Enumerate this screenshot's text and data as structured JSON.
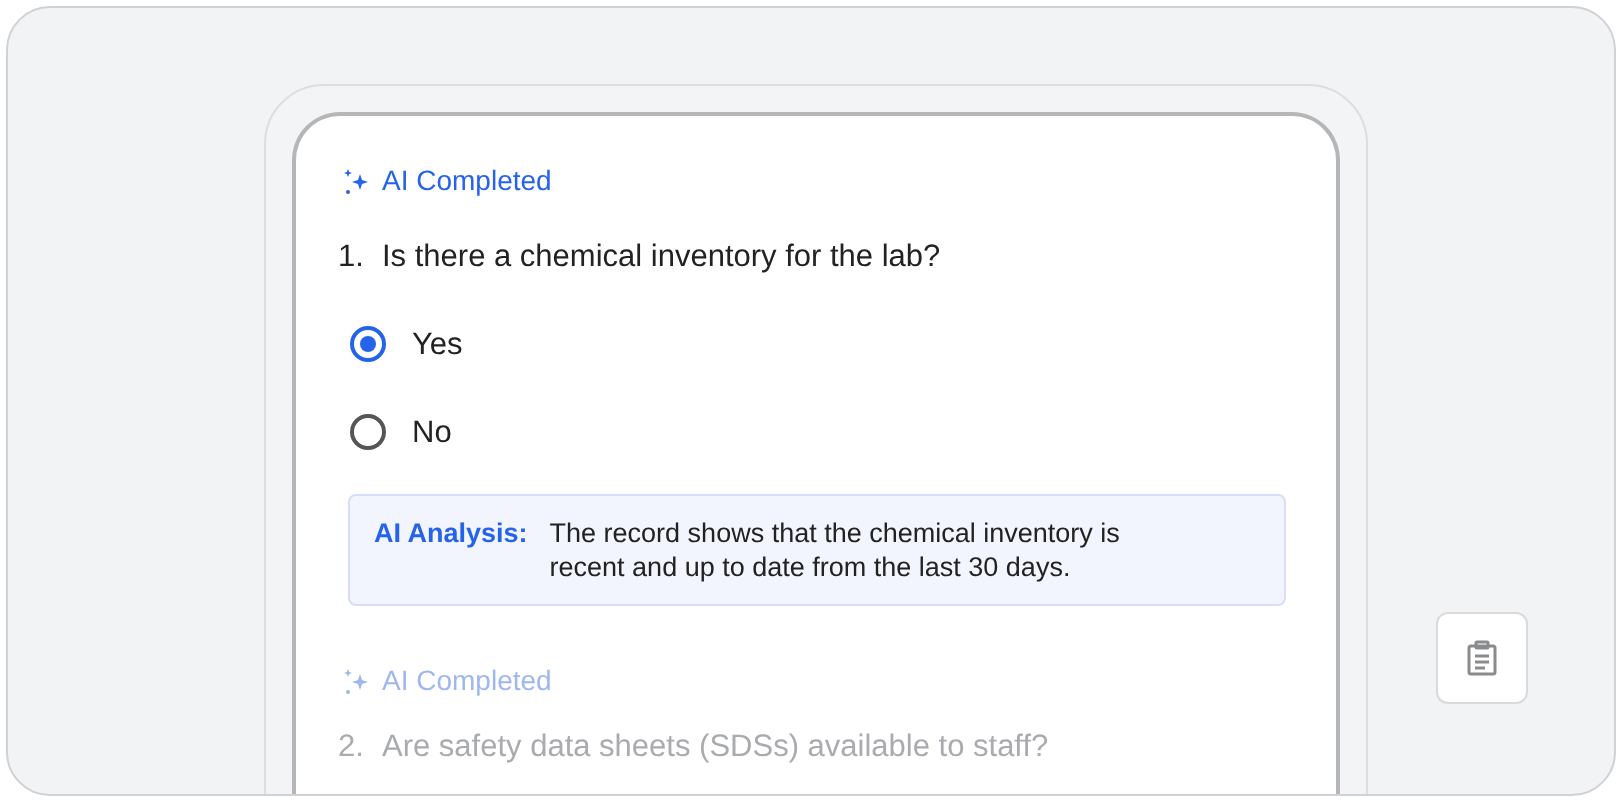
{
  "questions": [
    {
      "badge": "AI Completed",
      "number": "1.",
      "text": "Is there a chemical inventory for the lab?",
      "dimmed": false,
      "options": [
        {
          "label": "Yes",
          "selected": true
        },
        {
          "label": "No",
          "selected": false
        }
      ],
      "analysis": {
        "label": "AI Analysis:",
        "text": "The record shows that the chemical inventory is recent and up to date from the last 30 days."
      }
    },
    {
      "badge": "AI Completed",
      "number": "2.",
      "text": "Are safety data sheets (SDSs) available to staff?",
      "dimmed": true
    }
  ]
}
